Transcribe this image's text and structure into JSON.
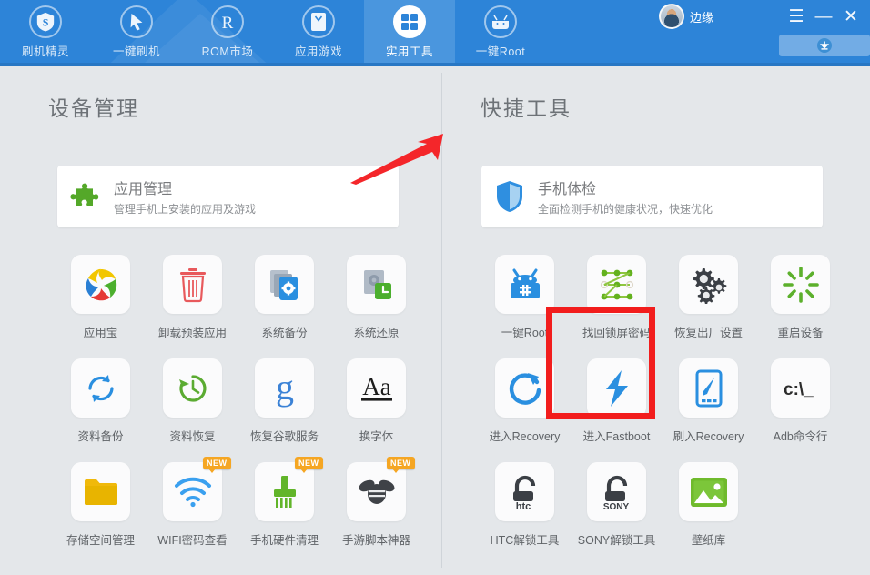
{
  "app": {
    "accent_blue": "#2d84d8",
    "active_tab_blue": "#4a96de",
    "page_bg": "#e4e7ea",
    "highlight_red": "#f21d1d",
    "badge_orange": "#f5a623"
  },
  "topbar": {
    "tabs": [
      {
        "label": "刷机精灵",
        "icon": "shield-s-icon",
        "active": false
      },
      {
        "label": "一键刷机",
        "icon": "cursor-arrow-icon",
        "active": false
      },
      {
        "label": "ROM市场",
        "icon": "registered-r-icon",
        "active": false
      },
      {
        "label": "应用游戏",
        "icon": "app-box-icon",
        "active": false
      },
      {
        "label": "实用工具",
        "icon": "grid-squares-icon",
        "active": true
      },
      {
        "label": "一键Root",
        "icon": "android-root-icon",
        "active": false
      }
    ],
    "user": {
      "name": "边缘",
      "avatar_icon": "user-avatar"
    },
    "window_controls": {
      "menu": "☰",
      "minimize": "—",
      "close": "✕"
    },
    "download_button": {
      "icon": "download-arrow-icon",
      "label": ""
    }
  },
  "left_panel": {
    "title": "设备管理",
    "feature_card": {
      "icon": "puzzle-piece-icon",
      "title": "应用管理",
      "subtitle": "管理手机上安装的应用及游戏"
    },
    "tiles": [
      {
        "label": "应用宝",
        "icon": "yingyongbao-logo-icon",
        "badge": ""
      },
      {
        "label": "卸载预装应用",
        "icon": "trash-can-icon",
        "badge": ""
      },
      {
        "label": "系统备份",
        "icon": "system-backup-icon",
        "badge": ""
      },
      {
        "label": "系统还原",
        "icon": "system-restore-icon",
        "badge": ""
      },
      {
        "label": "资料备份",
        "icon": "sync-refresh-icon",
        "badge": ""
      },
      {
        "label": "资料恢复",
        "icon": "clock-restore-icon",
        "badge": ""
      },
      {
        "label": "恢复谷歌服务",
        "icon": "google-g-icon",
        "badge": ""
      },
      {
        "label": "换字体",
        "icon": "font-aa-icon",
        "badge": ""
      },
      {
        "label": "存储空间管理",
        "icon": "folder-icon",
        "badge": ""
      },
      {
        "label": "WIFI密码查看",
        "icon": "wifi-icon",
        "badge": "NEW"
      },
      {
        "label": "手机硬件清理",
        "icon": "brush-clean-icon",
        "badge": "NEW"
      },
      {
        "label": "手游脚本神器",
        "icon": "bee-icon",
        "badge": "NEW"
      }
    ]
  },
  "right_panel": {
    "title": "快捷工具",
    "feature_card": {
      "icon": "shield-check-icon",
      "title": "手机体检",
      "subtitle": "全面检测手机的健康状况，快速优化"
    },
    "tiles": [
      {
        "label": "一键Root",
        "icon": "android-root-box-icon",
        "badge": "",
        "highlighted": false
      },
      {
        "label": "找回锁屏密码",
        "icon": "pattern-lock-icon",
        "badge": "",
        "highlighted": true
      },
      {
        "label": "恢复出厂设置",
        "icon": "gears-icon",
        "badge": "",
        "highlighted": false
      },
      {
        "label": "重启设备",
        "icon": "restart-burst-icon",
        "badge": "",
        "highlighted": false
      },
      {
        "label": "进入Recovery",
        "icon": "refresh-circle-icon",
        "badge": "",
        "highlighted": false
      },
      {
        "label": "进入Fastboot",
        "icon": "lightning-bolt-icon",
        "badge": "",
        "highlighted": false
      },
      {
        "label": "刷入Recovery",
        "icon": "phone-write-icon",
        "badge": "",
        "highlighted": false
      },
      {
        "label": "Adb命令行",
        "icon": "command-prompt-icon",
        "badge": "",
        "highlighted": false
      },
      {
        "label": "HTC解锁工具",
        "icon": "htc-unlock-icon",
        "badge": "",
        "highlighted": false
      },
      {
        "label": "SONY解锁工具",
        "icon": "sony-unlock-icon",
        "badge": "",
        "highlighted": false
      },
      {
        "label": "壁纸库",
        "icon": "picture-image-icon",
        "badge": "",
        "highlighted": false
      }
    ]
  },
  "annotations": {
    "arrow": {
      "name": "red-pointer-arrow",
      "color": "#f21d1d",
      "points_to": "实用工具"
    },
    "box": {
      "name": "red-highlight-box",
      "color": "#f21d1d",
      "surrounds": "找回锁屏密码"
    }
  }
}
